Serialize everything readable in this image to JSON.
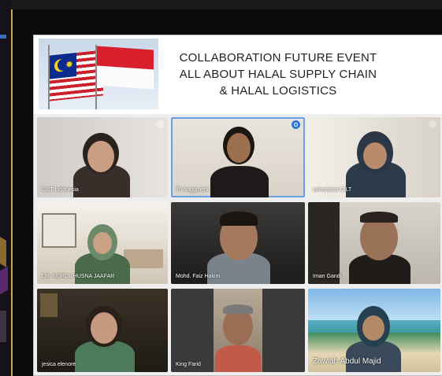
{
  "slide": {
    "title_lines": [
      "COLLABORATION FUTURE EVENT",
      "ALL ABOUT HALAL SUPPLY CHAIN",
      "& HALAL LOGISTICS"
    ]
  },
  "participants": [
    {
      "name": "CILT Indonesia"
    },
    {
      "name": "Tri Anggraeni"
    },
    {
      "name": "sekretariat CILT"
    },
    {
      "name": "DR. NURUL HUSNA JAAFAR"
    },
    {
      "name": "Mohd. Faiz Hakim"
    },
    {
      "name": "Iman Gandi"
    },
    {
      "name": "jesica elenore"
    },
    {
      "name": "King Farid"
    },
    {
      "name": "Zawiah Abdul Majid"
    }
  ],
  "icons": [
    "malaysia-flag-icon",
    "indonesia-flag-icon",
    "active-speaker-icon",
    "camera-off-icon"
  ]
}
